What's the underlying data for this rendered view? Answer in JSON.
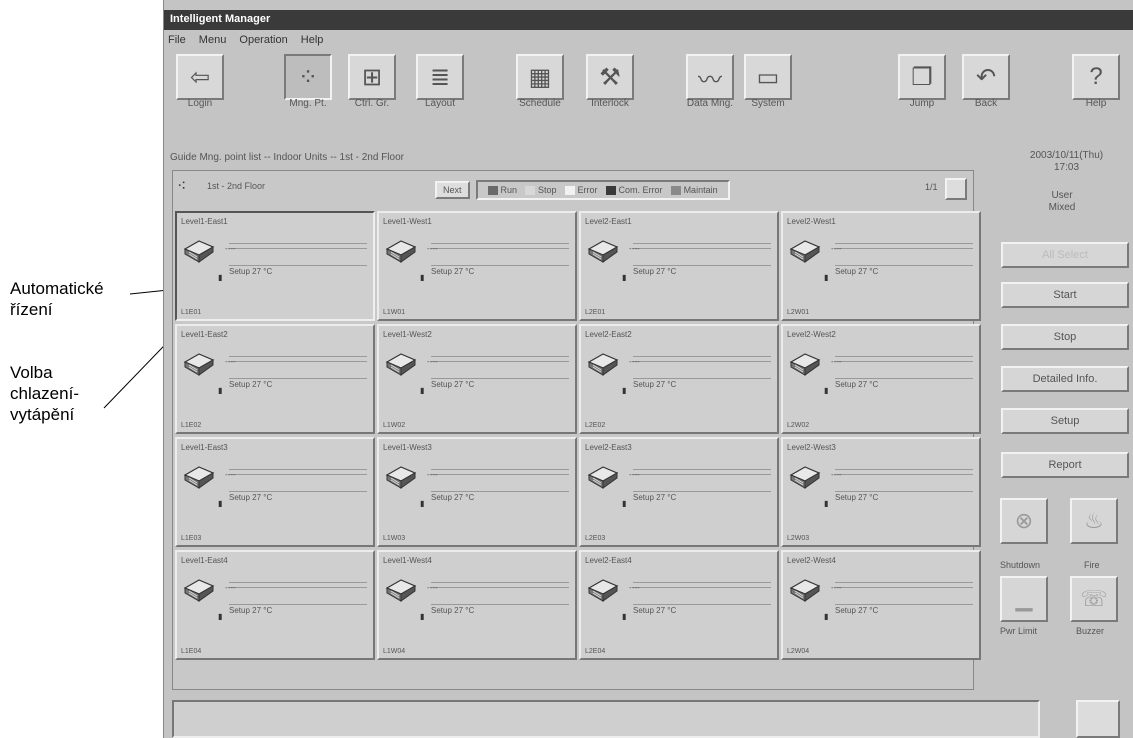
{
  "annotations": {
    "auto_control": [
      "Automatické",
      "řízení"
    ],
    "mode_select": [
      "Volba",
      "chlazení-",
      "vytápění"
    ]
  },
  "window": {
    "title": "Intelligent Manager",
    "menu": [
      "File",
      "Menu",
      "Operation",
      "Help"
    ]
  },
  "toolbar": [
    {
      "label": "Login",
      "icon": "login-icon"
    },
    {
      "label": "Mng. Pt.",
      "icon": "management-point-icon"
    },
    {
      "label": "Ctrl. Gr.",
      "icon": "control-group-icon"
    },
    {
      "label": "Layout",
      "icon": "layout-icon"
    },
    {
      "label": "Schedule",
      "icon": "schedule-icon"
    },
    {
      "label": "Interlock",
      "icon": "interlock-icon"
    },
    {
      "label": "Data Mng.",
      "icon": "data-management-icon"
    },
    {
      "label": "System",
      "icon": "system-icon"
    },
    {
      "label": "Jump",
      "icon": "jump-icon"
    },
    {
      "label": "Back",
      "icon": "back-icon"
    },
    {
      "label": "Help",
      "icon": "help-icon"
    }
  ],
  "guide": "Guide  Mng. point list -- Indoor Units -- 1st - 2nd Floor",
  "datetime": [
    "2003/10/11(Thu)",
    "17:03"
  ],
  "user": [
    "User",
    "Mixed"
  ],
  "floor": {
    "label": "1st - 2nd Floor",
    "page": "1/1",
    "next_label": "Next",
    "legend": [
      {
        "label": "Run",
        "color": "#6a6a6a"
      },
      {
        "label": "Stop",
        "color": "#d8d8d8"
      },
      {
        "label": "Error",
        "color": "#f2f2f2"
      },
      {
        "label": "Com. Error",
        "color": "#3a3a3a"
      },
      {
        "label": "Maintain",
        "color": "#8a8a8a"
      }
    ]
  },
  "units": [
    {
      "name": "Level1-East1",
      "setup": "Setup 27 °C",
      "code": "L1E01"
    },
    {
      "name": "Level1-West1",
      "setup": "Setup 27 °C",
      "code": "L1W01"
    },
    {
      "name": "Level2-East1",
      "setup": "Setup 27 °C",
      "code": "L2E01"
    },
    {
      "name": "Level2-West1",
      "setup": "Setup 27 °C",
      "code": "L2W01"
    },
    {
      "name": "Level1-East2",
      "setup": "Setup 27 °C",
      "code": "L1E02"
    },
    {
      "name": "Level1-West2",
      "setup": "Setup 27 °C",
      "code": "L1W02"
    },
    {
      "name": "Level2-East2",
      "setup": "Setup 27 °C",
      "code": "L2E02"
    },
    {
      "name": "Level2-West2",
      "setup": "Setup 27 °C",
      "code": "L2W02"
    },
    {
      "name": "Level1-East3",
      "setup": "Setup 27 °C",
      "code": "L1E03"
    },
    {
      "name": "Level1-West3",
      "setup": "Setup 27 °C",
      "code": "L1W03"
    },
    {
      "name": "Level2-East3",
      "setup": "Setup 27 °C",
      "code": "L2E03"
    },
    {
      "name": "Level2-West3",
      "setup": "Setup 27 °C",
      "code": "L2W03"
    },
    {
      "name": "Level1-East4",
      "setup": "Setup 27 °C",
      "code": "L1E04"
    },
    {
      "name": "Level1-West4",
      "setup": "Setup 27 °C",
      "code": "L1W04"
    },
    {
      "name": "Level2-East4",
      "setup": "Setup 27 °C",
      "code": "L2E04"
    },
    {
      "name": "Level2-West4",
      "setup": "Setup 27 °C",
      "code": "L2W04"
    }
  ],
  "unit_value_dash": "----",
  "unit_flag": "▮",
  "side_buttons": {
    "all": "All Select",
    "start": "Start",
    "stop": "Stop",
    "detailed": "Detailed Info.",
    "setup": "Setup",
    "report": "Report"
  },
  "side_icons": {
    "shutdown": "Shutdown",
    "fire": "Fire",
    "pwr_limit": "Pwr Limit",
    "buzzer": "Buzzer"
  }
}
